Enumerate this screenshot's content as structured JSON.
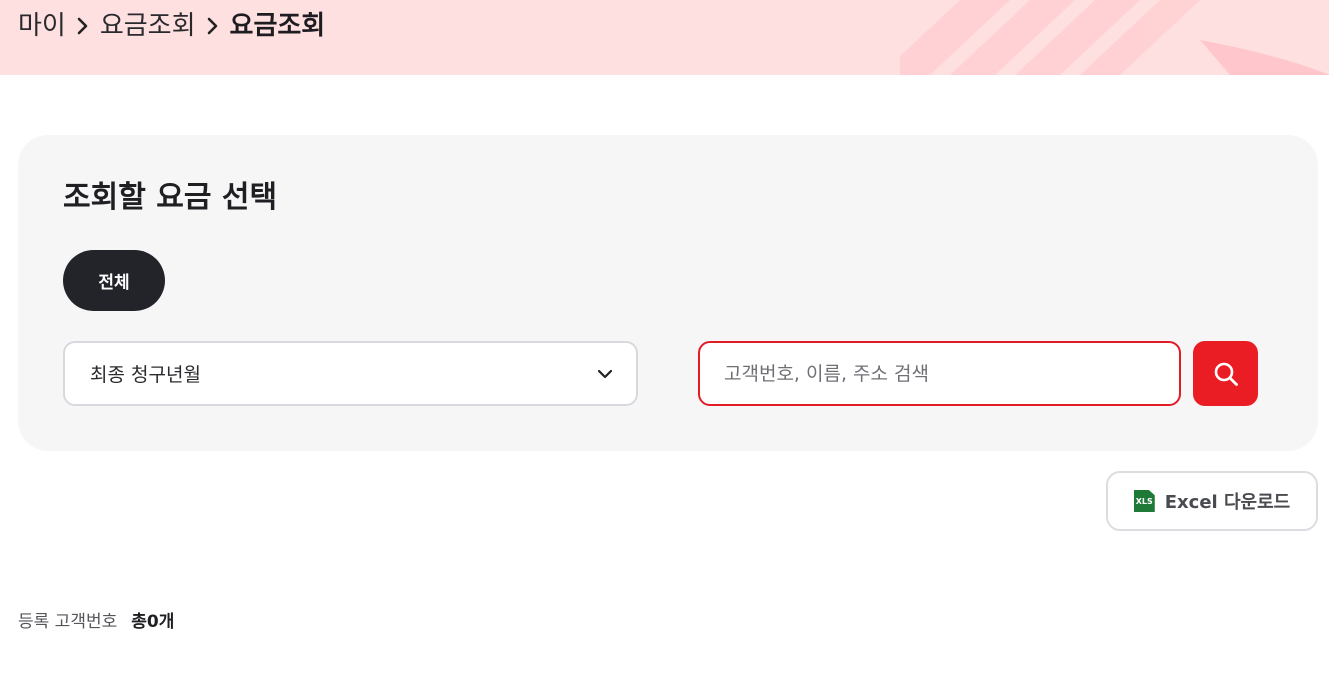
{
  "breadcrumb": {
    "items": [
      "마이",
      "요금조회"
    ],
    "current": "요금조회"
  },
  "panel": {
    "title": "조회할 요금 선택",
    "filter_chip": "전체",
    "period_select": {
      "value": "최종 청구년월",
      "icon": "chevron-down-icon"
    },
    "search": {
      "placeholder": "고객번호, 이름, 주소 검색",
      "value": ""
    },
    "search_button_icon": "search-icon"
  },
  "actions": {
    "excel_icon_text": "XLS",
    "excel_label": "Excel 다운로드"
  },
  "summary": {
    "label": "등록 고객번호",
    "count": "총0개"
  },
  "colors": {
    "header_bg": "#ffe0e1",
    "accent_red": "#ea1d25",
    "chip_dark": "#23242a",
    "panel_bg": "#f6f6f7",
    "excel_green": "#1f7a38"
  }
}
